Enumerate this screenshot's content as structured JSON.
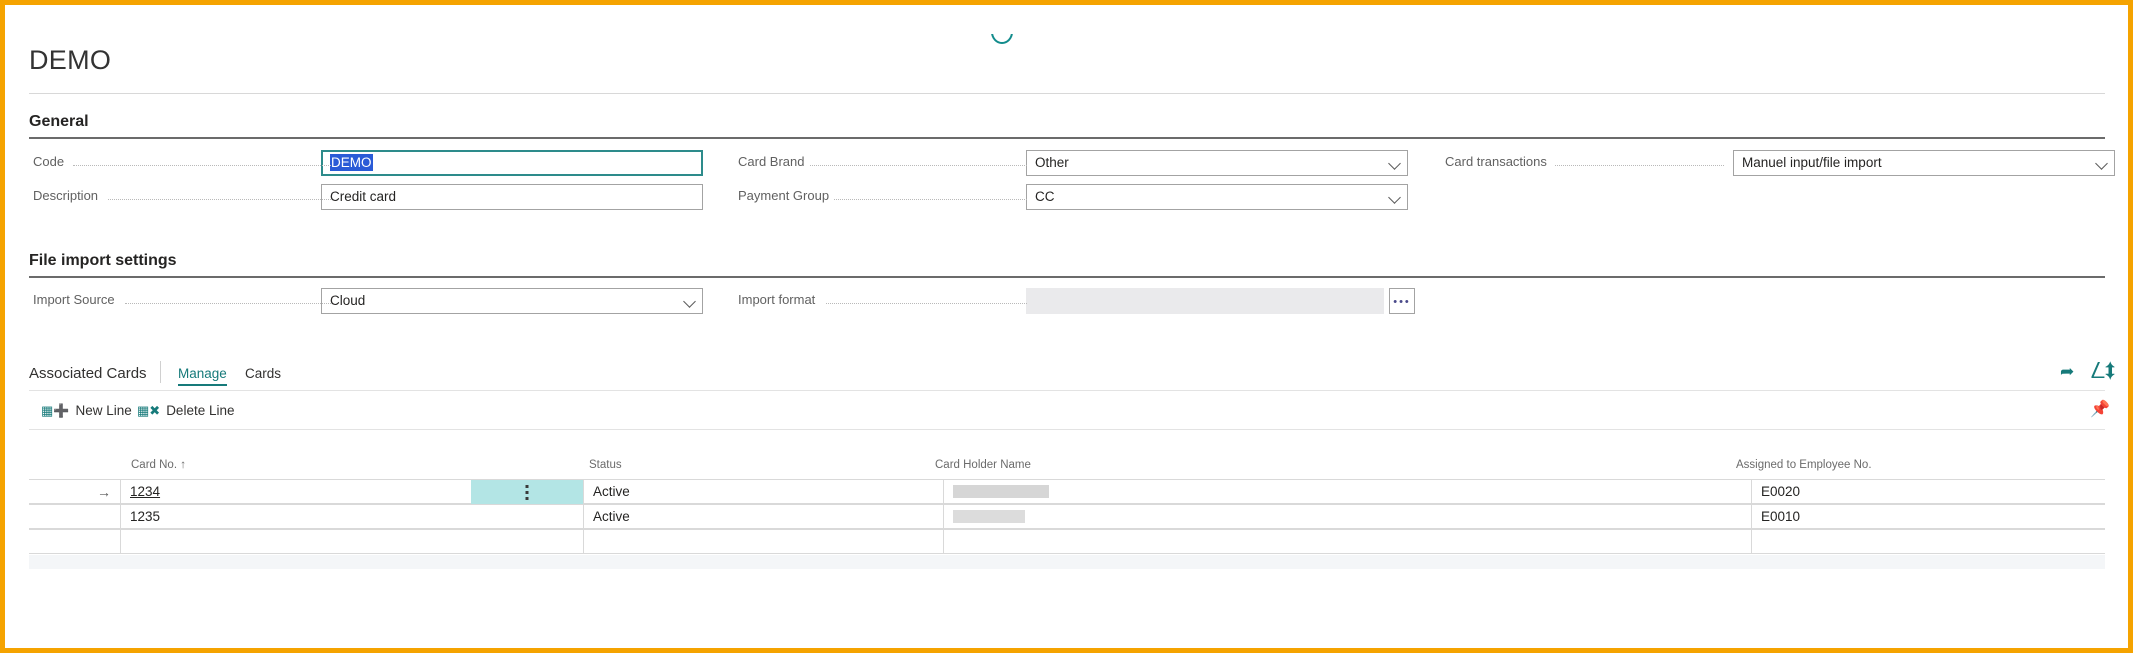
{
  "window": {
    "accent_border_color": "#f5a300"
  },
  "page": {
    "title": "DEMO"
  },
  "general": {
    "heading": "General",
    "fields": [
      {
        "label": "Code",
        "value": "DEMO",
        "state": "focused-selected",
        "control": "text"
      },
      {
        "label": "Description",
        "value": "Credit card",
        "control": "text"
      },
      {
        "label": "Card Brand",
        "value": "Other",
        "control": "dropdown"
      },
      {
        "label": "Payment Group",
        "value": "CC",
        "control": "dropdown"
      },
      {
        "label": "Card transactions",
        "value": "Manuel input/file import",
        "control": "dropdown"
      }
    ]
  },
  "file_import_settings": {
    "heading": "File import settings",
    "fields": [
      {
        "label": "Import Source",
        "value": "Cloud",
        "control": "dropdown"
      },
      {
        "label": "Import format",
        "value": "",
        "control": "assist-edit",
        "state": "disabled",
        "assist_label": "•••"
      }
    ]
  },
  "associated_cards": {
    "title": "Associated Cards",
    "menus": [
      {
        "label": "Manage",
        "active": true
      },
      {
        "label": "Cards",
        "active": false
      }
    ],
    "commands": [
      {
        "label": "New Line",
        "icon": "new-line-icon"
      },
      {
        "label": "Delete Line",
        "icon": "delete-line-icon"
      }
    ],
    "corner_actions": [
      {
        "name": "open-in-excel-icon",
        "glyph": "↪"
      },
      {
        "name": "open-in-full-page-icon",
        "glyph": "⬚"
      },
      {
        "name": "unpin-icon",
        "glyph": "✐"
      }
    ],
    "columns": [
      {
        "label": "Card No. ↑"
      },
      {
        "label": "Status"
      },
      {
        "label": "Card Holder Name"
      },
      {
        "label": "Assigned to Employee No."
      }
    ],
    "rows": [
      {
        "indicator": "→",
        "selected": true,
        "card_no": "1234",
        "status": "Active",
        "card_holder_name": "",
        "card_holder_redacted": true,
        "assigned_to_employee_no": "E0020"
      },
      {
        "indicator": "",
        "selected": false,
        "card_no": "1235",
        "status": "Active",
        "card_holder_name": "",
        "card_holder_redacted": true,
        "assigned_to_employee_no": "E0010"
      },
      {
        "indicator": "",
        "selected": false,
        "card_no": "",
        "status": "",
        "card_holder_name": "",
        "card_holder_redacted": false,
        "assigned_to_employee_no": ""
      }
    ]
  }
}
